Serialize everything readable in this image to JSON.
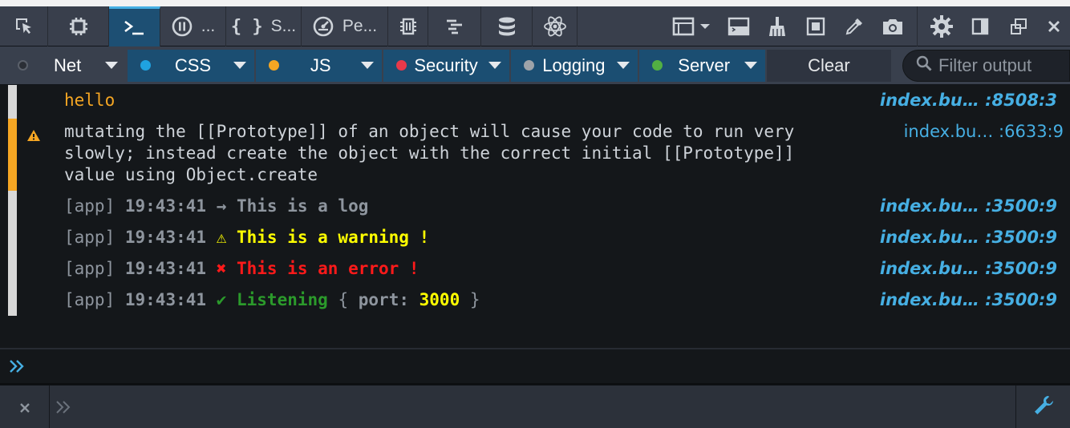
{
  "toolbar": {
    "tabs": [
      {
        "icon": "inspect-icon"
      },
      {
        "icon": "layout-chip-icon"
      },
      {
        "icon": "console-prompt-icon",
        "selected": true
      },
      {
        "icon": "pause-circle-icon",
        "label": "..."
      },
      {
        "icon": "braces-icon",
        "label": "S..."
      },
      {
        "icon": "gauge-icon",
        "label": "Pe..."
      }
    ],
    "right_icons": [
      "memory-icon",
      "waterfall-icon",
      "storage-db-icon",
      "react-atom-icon",
      "frame-select-icon",
      "split-console-icon",
      "broom-icon",
      "responsive-icon",
      "eyedropper-icon",
      "camera-icon",
      "gear-icon",
      "dock-side-icon",
      "popout-icon",
      "close-icon"
    ]
  },
  "filters": {
    "net": {
      "label": "Net",
      "color": "#2b2f36",
      "checked": false
    },
    "css": {
      "label": "CSS",
      "color": "#1fa2e0",
      "checked": true
    },
    "js": {
      "label": "JS",
      "color": "#f5a623",
      "checked": true
    },
    "security": {
      "label": "Security",
      "color": "#e8394a",
      "checked": true
    },
    "logging": {
      "label": "Logging",
      "color": "#9ea3a9",
      "checked": true
    },
    "server": {
      "label": "Server",
      "color": "#52b043",
      "checked": true
    },
    "clear_label": "Clear",
    "filter_placeholder": "Filter output"
  },
  "messages": {
    "m1": {
      "text": "hello",
      "source": "index.bu… :8508:3"
    },
    "m2": {
      "line1": "mutating the [[Prototype]] of an object will cause your code to run very",
      "line2": "slowly; instead create the object with the correct initial [[Prototype]]",
      "line3": "value using Object.create",
      "source": "index.bu… :6633:9"
    },
    "m3": {
      "prefix": "[app]",
      "time": "19:43:41",
      "arrow": "→",
      "text": "This is a log",
      "source": "index.bu… :3500:9"
    },
    "m4": {
      "prefix": "[app]",
      "time": "19:43:41",
      "icon": "⚠",
      "text": "This is a warning !",
      "source": "index.bu… :3500:9"
    },
    "m5": {
      "prefix": "[app]",
      "time": "19:43:41",
      "icon": "✖",
      "text": "This is an error !",
      "source": "index.bu… :3500:9"
    },
    "m6": {
      "prefix": "[app]",
      "time": "19:43:41",
      "icon": "✔",
      "text": "Listening",
      "open": "{",
      "key": "port:",
      "value": "3000",
      "close": "}",
      "source": "index.bu… :3500:9"
    }
  },
  "colors": {
    "accent": "#46afe3",
    "warn": "#f5a623",
    "yellow": "#ffff00",
    "red": "#ff1a1a",
    "green": "#2b9a2b"
  }
}
